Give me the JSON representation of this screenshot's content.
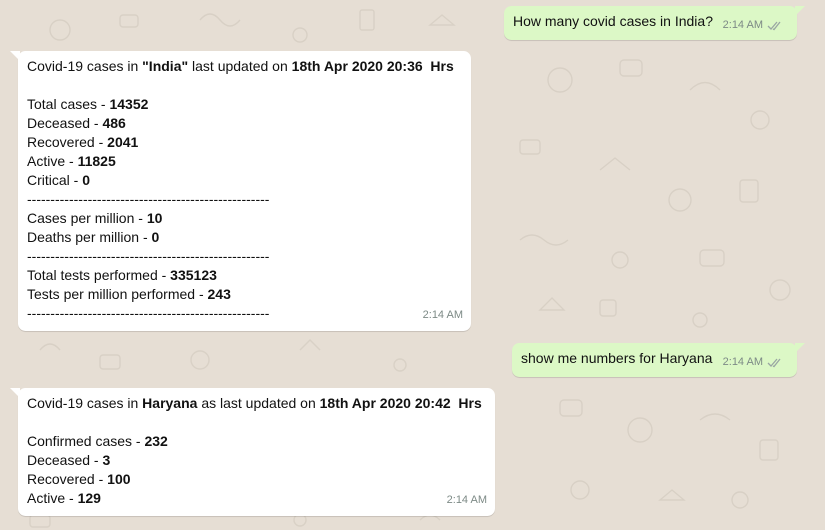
{
  "colors": {
    "chat_background": "#e6ded4",
    "outgoing_bubble": "#dcf8c6",
    "incoming_bubble": "#ffffff",
    "timestamp": "#7d8a86"
  },
  "messages": [
    {
      "direction": "outgoing",
      "text": "How many covid cases in India?",
      "time": "2:14 AM",
      "status_icon": "double-check-icon"
    },
    {
      "direction": "incoming",
      "intro": {
        "prefix": "Covid-19 cases in ",
        "place": "\"India\"",
        "middle": " last updated on ",
        "date": "18th Apr 2020 20:36  Hrs"
      },
      "stats1": [
        {
          "label": "Total cases - ",
          "value": "14352"
        },
        {
          "label": "Deceased - ",
          "value": "486"
        },
        {
          "label": "Recovered - ",
          "value": "2041"
        },
        {
          "label": "Active - ",
          "value": "11825"
        },
        {
          "label": "Critical - ",
          "value": "0"
        }
      ],
      "separator": "----------------------------------------------------",
      "stats2": [
        {
          "label": "Cases per million - ",
          "value": "10"
        },
        {
          "label": "Deaths per million - ",
          "value": "0"
        }
      ],
      "stats3": [
        {
          "label": "Total tests performed - ",
          "value": "335123"
        },
        {
          "label": "Tests per million performed - ",
          "value": "243"
        }
      ],
      "time": "2:14 AM"
    },
    {
      "direction": "outgoing",
      "text": "show me numbers for Haryana",
      "time": "2:14 AM",
      "status_icon": "double-check-icon"
    },
    {
      "direction": "incoming",
      "intro": {
        "prefix": "Covid-19 cases in ",
        "place": "Haryana",
        "middle": " as last updated on ",
        "date": "18th Apr 2020 20:42  Hrs"
      },
      "stats1": [
        {
          "label": "Confirmed cases - ",
          "value": "232"
        },
        {
          "label": "Deceased - ",
          "value": "3"
        },
        {
          "label": "Recovered - ",
          "value": "100"
        },
        {
          "label": "Active - ",
          "value": "129"
        }
      ],
      "time": "2:14 AM"
    }
  ]
}
